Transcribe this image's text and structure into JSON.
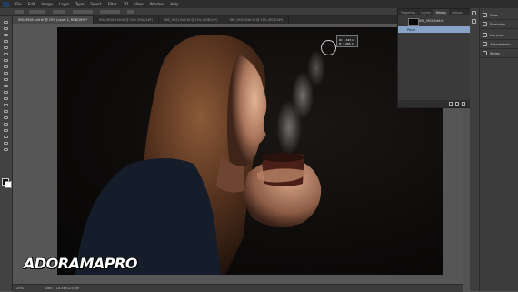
{
  "app": {
    "name": "Photoshop"
  },
  "menubar": {
    "items": [
      "File",
      "Edit",
      "Image",
      "Layer",
      "Type",
      "Select",
      "Filter",
      "3D",
      "View",
      "Window",
      "Help"
    ]
  },
  "document_tabs": [
    {
      "label": "IMG_9928-Edit.tif @ 25% (Layer 1, RGB/16*) *",
      "active": true
    },
    {
      "label": "IMG_9928-Edit.tif @ 25% (RGB/16*)",
      "active": false
    },
    {
      "label": "IMG_9931-Edit.tif @ 25% (RGB/16*)",
      "active": false
    },
    {
      "label": "IMG_9935-Edit.tif @ 25% (RGB/16*)",
      "active": false
    }
  ],
  "history_panel": {
    "tabs": [
      {
        "label": "Properties",
        "active": false
      },
      {
        "label": "Layers",
        "active": false
      },
      {
        "label": "History",
        "active": true
      },
      {
        "label": "Actions",
        "active": false
      }
    ],
    "snapshot_label": "IMG_9928-Edit.tif",
    "states": [
      {
        "label": "Paste",
        "selected": true
      }
    ]
  },
  "right_dock": {
    "items": [
      {
        "label": "Color",
        "icon": "color-wheel-icon"
      },
      {
        "label": "Swatches",
        "icon": "swatches-icon"
      },
      {
        "label": "Libraries",
        "icon": "libraries-icon"
      },
      {
        "label": "Adjustments",
        "icon": "adjustments-icon"
      },
      {
        "label": "Styles",
        "icon": "styles-icon"
      }
    ]
  },
  "canvas_info": {
    "line1": "W: 1.323 in",
    "line2": "H: 1.265 in"
  },
  "status": {
    "zoom": "25%",
    "doc_size": "Doc: 114.3M/125.9M"
  },
  "watermark": "ADORAMAPRO",
  "colors": {
    "accent_selection": "#87a4c8",
    "foreground_swatch": "#111111",
    "background_swatch": "#ffffff"
  }
}
